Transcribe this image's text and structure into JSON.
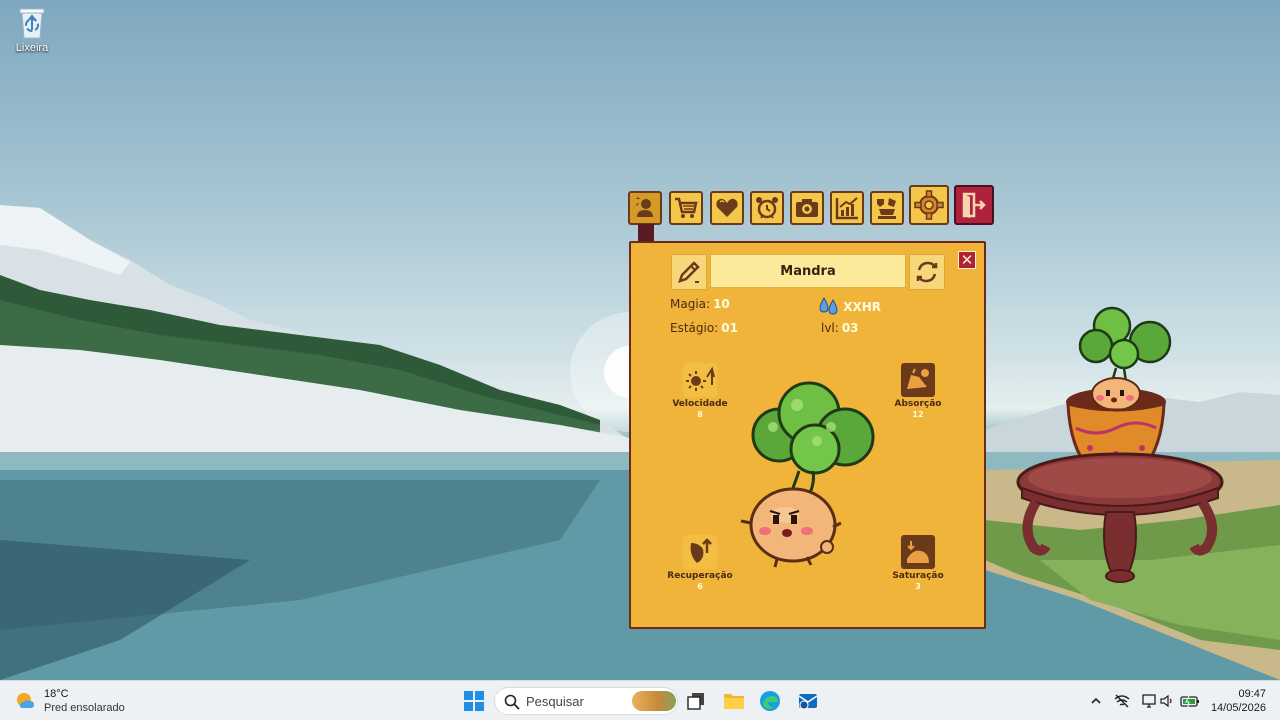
{
  "desktop": {
    "icons": [
      {
        "label": "Lixeira",
        "icon": "recycle-bin-icon"
      }
    ]
  },
  "game": {
    "toolbar": [
      {
        "icon": "pet-profile-icon"
      },
      {
        "icon": "shop-cart-icon"
      },
      {
        "icon": "heart-care-icon"
      },
      {
        "icon": "alarm-clock-icon"
      },
      {
        "icon": "camera-icon"
      },
      {
        "icon": "stats-chart-icon"
      },
      {
        "icon": "balance-icon"
      },
      {
        "icon": "settings-gear-icon"
      },
      {
        "icon": "exit-door-icon"
      }
    ],
    "panel": {
      "pet_name": "Mandra",
      "magia_label": "Magia:",
      "magia_value": "10",
      "water_value": "XXHR",
      "estagio_label": "Estágio:",
      "estagio_value": "01",
      "lvl_label": "lvl:",
      "lvl_value": "03",
      "attributes": {
        "velocidade": {
          "label": "Velocidade",
          "value": "8"
        },
        "absorcao": {
          "label": "Absorção",
          "value": "12"
        },
        "recuperacao": {
          "label": "Recuperação",
          "value": "6"
        },
        "saturacao": {
          "label": "Saturação",
          "value": "3"
        }
      }
    }
  },
  "taskbar": {
    "weather_temp": "18°C",
    "weather_desc": "Pred ensolarado",
    "search_placeholder": "Pesquisar",
    "time": "09:47",
    "date": "14/05/2026"
  },
  "colors": {
    "panel_bg": "#f0b43a",
    "toolbar_btn": "#f4c64a",
    "exit_btn": "#b0223b",
    "taskbar_bg": "#eef1f4"
  }
}
